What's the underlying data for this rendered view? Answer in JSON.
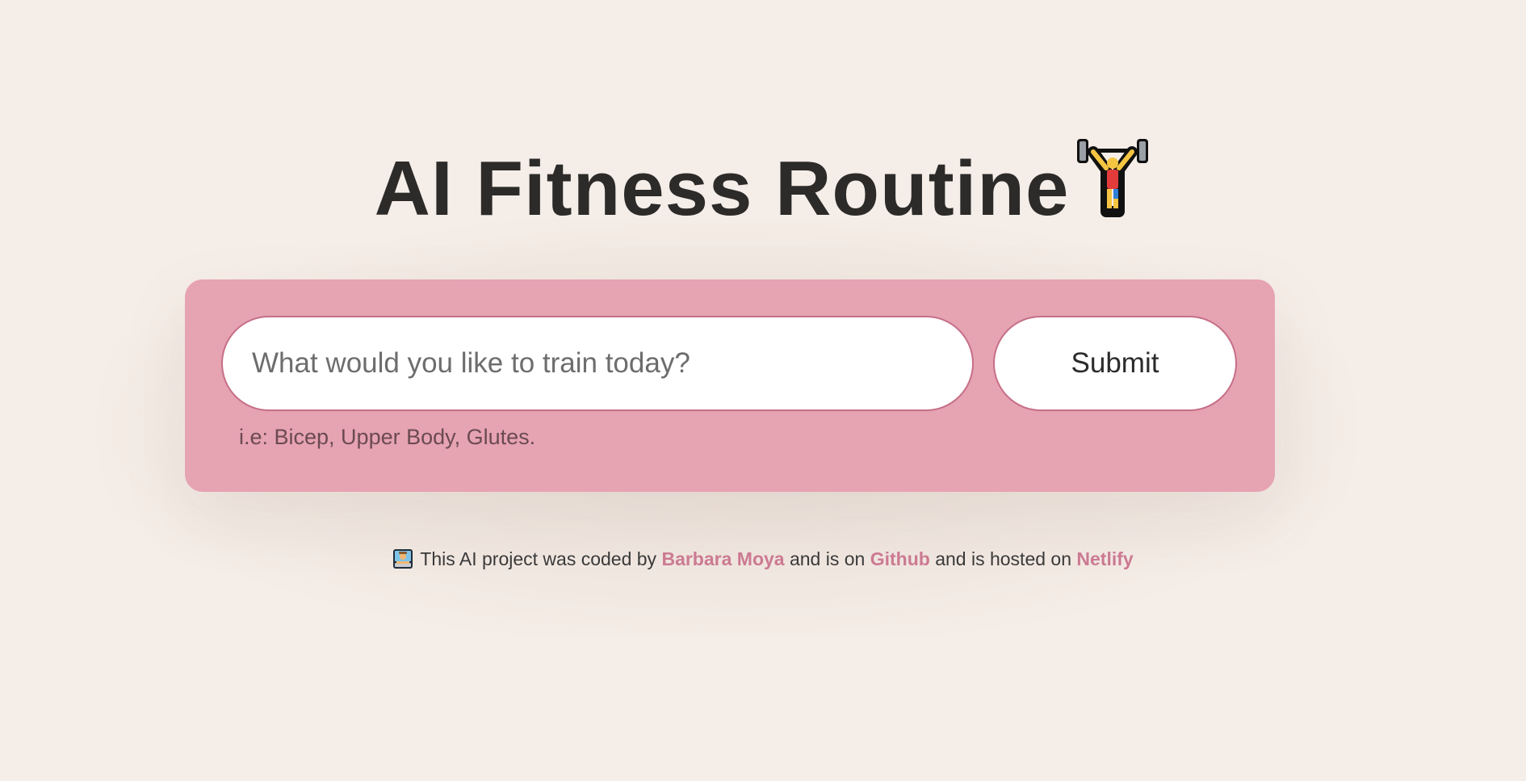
{
  "header": {
    "title": "AI Fitness Routine"
  },
  "icons": {
    "title_icon": "weightlifter-icon",
    "footer_icon": "woman-technologist-icon"
  },
  "form": {
    "search_placeholder": "What would you like to train today?",
    "search_value": "",
    "submit_label": "Submit",
    "hint": "i.e: Bicep, Upper Body, Glutes."
  },
  "footer": {
    "text_1": "This AI project was coded by",
    "author_link": "Barbara Moya",
    "text_2": "and is on",
    "github_link": "Github",
    "text_3": "and is hosted on",
    "netlify_link": "Netlify"
  },
  "colors": {
    "background": "#f5ede7",
    "panel": "#e6a3b2",
    "accent": "#cc7a92",
    "input_border": "#c66f88",
    "text": "#2c2b29"
  }
}
